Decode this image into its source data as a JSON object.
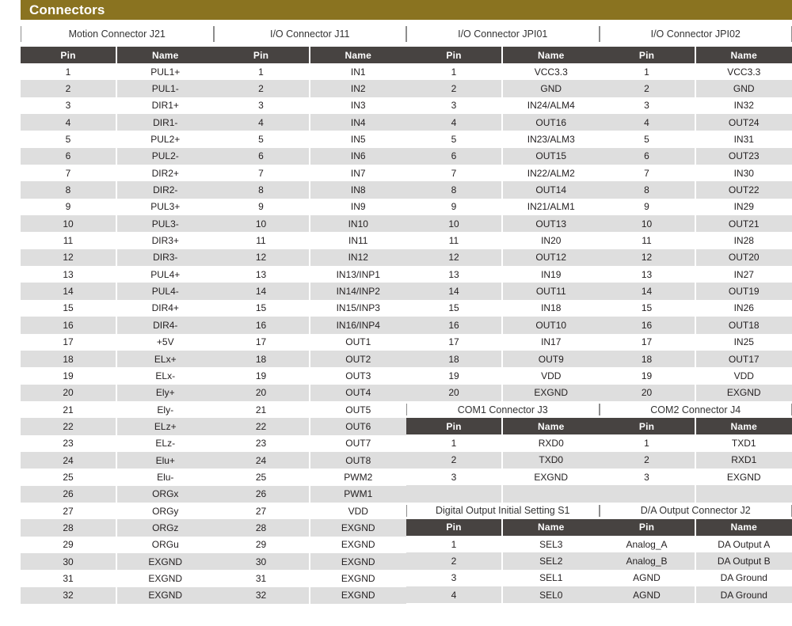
{
  "header": {
    "title": "Connectors",
    "bar_color": "#8a7320"
  },
  "table_header": {
    "pin_label": "Pin",
    "name_label": "Name",
    "header_bg": "#474341",
    "alt_row_bg": "#dedede"
  },
  "columns": [
    {
      "caption": "Motion Connector J21",
      "rows": [
        {
          "pin": "1",
          "name": "PUL1+"
        },
        {
          "pin": "2",
          "name": "PUL1-"
        },
        {
          "pin": "3",
          "name": "DIR1+"
        },
        {
          "pin": "4",
          "name": "DIR1-"
        },
        {
          "pin": "5",
          "name": "PUL2+"
        },
        {
          "pin": "6",
          "name": "PUL2-"
        },
        {
          "pin": "7",
          "name": "DIR2+"
        },
        {
          "pin": "8",
          "name": "DIR2-"
        },
        {
          "pin": "9",
          "name": "PUL3+"
        },
        {
          "pin": "10",
          "name": "PUL3-"
        },
        {
          "pin": "11",
          "name": "DIR3+"
        },
        {
          "pin": "12",
          "name": "DIR3-"
        },
        {
          "pin": "13",
          "name": "PUL4+"
        },
        {
          "pin": "14",
          "name": "PUL4-"
        },
        {
          "pin": "15",
          "name": "DIR4+"
        },
        {
          "pin": "16",
          "name": "DIR4-"
        },
        {
          "pin": "17",
          "name": "+5V"
        },
        {
          "pin": "18",
          "name": "ELx+"
        },
        {
          "pin": "19",
          "name": "ELx-"
        },
        {
          "pin": "20",
          "name": "Ely+"
        },
        {
          "pin": "21",
          "name": "Ely-"
        },
        {
          "pin": "22",
          "name": "ELz+"
        },
        {
          "pin": "23",
          "name": "ELz-"
        },
        {
          "pin": "24",
          "name": "Elu+"
        },
        {
          "pin": "25",
          "name": "Elu-"
        },
        {
          "pin": "26",
          "name": "ORGx"
        },
        {
          "pin": "27",
          "name": "ORGy"
        },
        {
          "pin": "28",
          "name": "ORGz"
        },
        {
          "pin": "29",
          "name": "ORGu"
        },
        {
          "pin": "30",
          "name": "EXGND"
        },
        {
          "pin": "31",
          "name": "EXGND"
        },
        {
          "pin": "32",
          "name": "EXGND"
        }
      ],
      "subtables": []
    },
    {
      "caption": "I/O Connector J11",
      "rows": [
        {
          "pin": "1",
          "name": "IN1"
        },
        {
          "pin": "2",
          "name": "IN2"
        },
        {
          "pin": "3",
          "name": "IN3"
        },
        {
          "pin": "4",
          "name": "IN4"
        },
        {
          "pin": "5",
          "name": "IN5"
        },
        {
          "pin": "6",
          "name": "IN6"
        },
        {
          "pin": "7",
          "name": "IN7"
        },
        {
          "pin": "8",
          "name": "IN8"
        },
        {
          "pin": "9",
          "name": "IN9"
        },
        {
          "pin": "10",
          "name": "IN10"
        },
        {
          "pin": "11",
          "name": "IN11"
        },
        {
          "pin": "12",
          "name": "IN12"
        },
        {
          "pin": "13",
          "name": "IN13/INP1"
        },
        {
          "pin": "14",
          "name": "IN14/INP2"
        },
        {
          "pin": "15",
          "name": "IN15/INP3"
        },
        {
          "pin": "16",
          "name": "IN16/INP4"
        },
        {
          "pin": "17",
          "name": "OUT1"
        },
        {
          "pin": "18",
          "name": "OUT2"
        },
        {
          "pin": "19",
          "name": "OUT3"
        },
        {
          "pin": "20",
          "name": "OUT4"
        },
        {
          "pin": "21",
          "name": "OUT5"
        },
        {
          "pin": "22",
          "name": "OUT6"
        },
        {
          "pin": "23",
          "name": "OUT7"
        },
        {
          "pin": "24",
          "name": "OUT8"
        },
        {
          "pin": "25",
          "name": "PWM2"
        },
        {
          "pin": "26",
          "name": "PWM1"
        },
        {
          "pin": "27",
          "name": "VDD"
        },
        {
          "pin": "28",
          "name": "EXGND"
        },
        {
          "pin": "29",
          "name": "EXGND"
        },
        {
          "pin": "30",
          "name": "EXGND"
        },
        {
          "pin": "31",
          "name": "EXGND"
        },
        {
          "pin": "32",
          "name": "EXGND"
        }
      ],
      "subtables": []
    },
    {
      "caption": "I/O Connector JPI01",
      "rows": [
        {
          "pin": "1",
          "name": "VCC3.3"
        },
        {
          "pin": "2",
          "name": "GND"
        },
        {
          "pin": "3",
          "name": "IN24/ALM4"
        },
        {
          "pin": "4",
          "name": "OUT16"
        },
        {
          "pin": "5",
          "name": "IN23/ALM3"
        },
        {
          "pin": "6",
          "name": "OUT15"
        },
        {
          "pin": "7",
          "name": "IN22/ALM2"
        },
        {
          "pin": "8",
          "name": "OUT14"
        },
        {
          "pin": "9",
          "name": "IN21/ALM1"
        },
        {
          "pin": "10",
          "name": "OUT13"
        },
        {
          "pin": "11",
          "name": "IN20"
        },
        {
          "pin": "12",
          "name": "OUT12"
        },
        {
          "pin": "13",
          "name": "IN19"
        },
        {
          "pin": "14",
          "name": "OUT11"
        },
        {
          "pin": "15",
          "name": "IN18"
        },
        {
          "pin": "16",
          "name": "OUT10"
        },
        {
          "pin": "17",
          "name": "IN17"
        },
        {
          "pin": "18",
          "name": "OUT9"
        },
        {
          "pin": "19",
          "name": "VDD"
        },
        {
          "pin": "20",
          "name": "EXGND"
        }
      ],
      "subtables": [
        {
          "caption": "COM1 Connector J3",
          "rows": [
            {
              "pin": "1",
              "name": "RXD0"
            },
            {
              "pin": "2",
              "name": "TXD0"
            },
            {
              "pin": "3",
              "name": "EXGND"
            }
          ]
        },
        {
          "caption": "Digital Output Initial Setting S1",
          "rows": [
            {
              "pin": "1",
              "name": "SEL3"
            },
            {
              "pin": "2",
              "name": "SEL2"
            },
            {
              "pin": "3",
              "name": "SEL1"
            },
            {
              "pin": "4",
              "name": "SEL0"
            }
          ]
        }
      ]
    },
    {
      "caption": "I/O Connector JPI02",
      "rows": [
        {
          "pin": "1",
          "name": "VCC3.3"
        },
        {
          "pin": "2",
          "name": "GND"
        },
        {
          "pin": "3",
          "name": "IN32"
        },
        {
          "pin": "4",
          "name": "OUT24"
        },
        {
          "pin": "5",
          "name": "IN31"
        },
        {
          "pin": "6",
          "name": "OUT23"
        },
        {
          "pin": "7",
          "name": "IN30"
        },
        {
          "pin": "8",
          "name": "OUT22"
        },
        {
          "pin": "9",
          "name": "IN29"
        },
        {
          "pin": "10",
          "name": "OUT21"
        },
        {
          "pin": "11",
          "name": "IN28"
        },
        {
          "pin": "12",
          "name": "OUT20"
        },
        {
          "pin": "13",
          "name": "IN27"
        },
        {
          "pin": "14",
          "name": "OUT19"
        },
        {
          "pin": "15",
          "name": "IN26"
        },
        {
          "pin": "16",
          "name": "OUT18"
        },
        {
          "pin": "17",
          "name": "IN25"
        },
        {
          "pin": "18",
          "name": "OUT17"
        },
        {
          "pin": "19",
          "name": "VDD"
        },
        {
          "pin": "20",
          "name": "EXGND"
        }
      ],
      "subtables": [
        {
          "caption": "COM2 Connector J4",
          "rows": [
            {
              "pin": "1",
              "name": "TXD1"
            },
            {
              "pin": "2",
              "name": "RXD1"
            },
            {
              "pin": "3",
              "name": "EXGND"
            }
          ]
        },
        {
          "caption": "D/A Output Connector J2",
          "rows": [
            {
              "pin": "Analog_A",
              "name": "DA Output A"
            },
            {
              "pin": "Analog_B",
              "name": "DA Output B"
            },
            {
              "pin": "AGND",
              "name": "DA Ground"
            },
            {
              "pin": "AGND",
              "name": "DA Ground"
            }
          ]
        }
      ]
    }
  ]
}
